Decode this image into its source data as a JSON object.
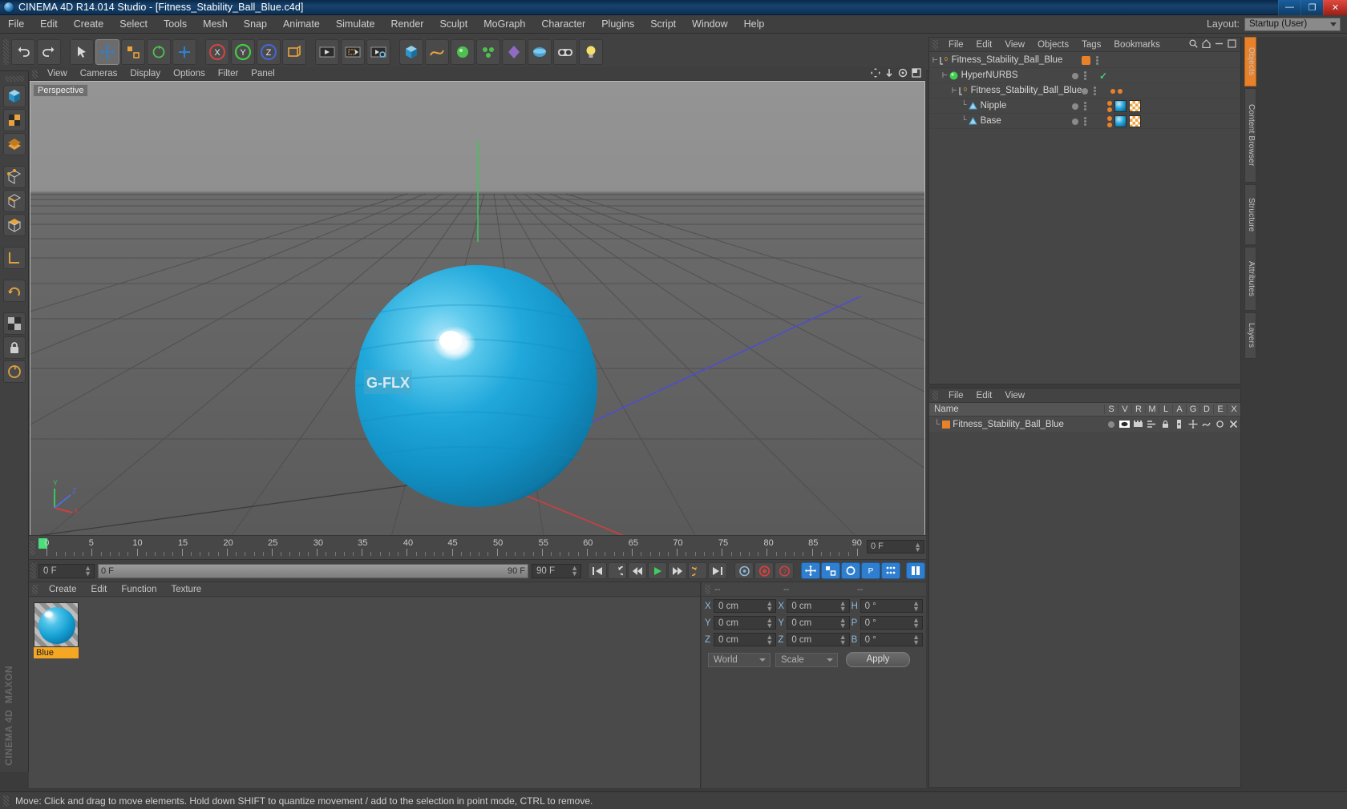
{
  "titlebar": {
    "title": "CINEMA 4D R14.014 Studio - [Fitness_Stability_Ball_Blue.c4d]",
    "app_icon": "c4d-logo-icon",
    "minimize": "—",
    "maximize": "❐",
    "close": "✕"
  },
  "menubar": {
    "items": [
      "File",
      "Edit",
      "Create",
      "Select",
      "Tools",
      "Mesh",
      "Snap",
      "Animate",
      "Simulate",
      "Render",
      "Sculpt",
      "MoGraph",
      "Character",
      "Plugins",
      "Script",
      "Window",
      "Help"
    ],
    "layout_label": "Layout:",
    "layout_value": "Startup (User)"
  },
  "viewport": {
    "menu": [
      "View",
      "Cameras",
      "Display",
      "Options",
      "Filter",
      "Panel"
    ],
    "label": "Perspective",
    "axis_x": "X",
    "axis_y": "Y",
    "axis_z": "Z",
    "logo_text": "G-FLX",
    "ball_color": "#24a8d8"
  },
  "timeline": {
    "ticks": [
      "0",
      "5",
      "10",
      "15",
      "20",
      "25",
      "30",
      "35",
      "40",
      "45",
      "50",
      "55",
      "60",
      "65",
      "70",
      "75",
      "80",
      "85",
      "90"
    ],
    "end_field": "0 F",
    "current_frame": "0 F",
    "range_start": "0 F",
    "range_end": "90 F",
    "max_frame": "90 F"
  },
  "transport": {
    "buttons": [
      {
        "name": "go-to-start-button",
        "glyph": "⏮"
      },
      {
        "name": "play-reverse-button",
        "glyph": "↺"
      },
      {
        "name": "step-back-button",
        "glyph": "◀◀"
      },
      {
        "name": "play-button",
        "glyph": "▶"
      },
      {
        "name": "step-forward-button",
        "glyph": "▶▶"
      },
      {
        "name": "play-forward-loop-button",
        "glyph": "↻"
      },
      {
        "name": "go-to-end-button",
        "glyph": "⏭"
      }
    ],
    "record_buttons": [
      {
        "name": "autokey-button",
        "glyph": "◎"
      },
      {
        "name": "record-button",
        "glyph": "●"
      },
      {
        "name": "keyframe-selection-button",
        "glyph": "?"
      }
    ],
    "param_buttons": [
      {
        "name": "record-position-button",
        "glyph": "✥"
      },
      {
        "name": "record-scale-button",
        "glyph": "❑"
      },
      {
        "name": "record-rotation-button",
        "glyph": "↻"
      },
      {
        "name": "record-param-button",
        "glyph": "P"
      },
      {
        "name": "record-pla-button",
        "glyph": "∷"
      }
    ],
    "timeline_toggle": {
      "name": "timeline-toggle-button",
      "glyph": "‖"
    }
  },
  "material_manager": {
    "menu": [
      "Create",
      "Edit",
      "Function",
      "Texture"
    ],
    "materials": [
      {
        "name": "Blue",
        "color": "#24a8d8",
        "selected": true
      }
    ]
  },
  "coordinates": {
    "header_left": "--",
    "header_mid": "--",
    "header_right": "--",
    "rows": [
      {
        "pos_label": "X",
        "pos_value": "0 cm",
        "size_label": "X",
        "size_value": "0 cm",
        "rot_label": "H",
        "rot_value": "0 °"
      },
      {
        "pos_label": "Y",
        "pos_value": "0 cm",
        "size_label": "Y",
        "size_value": "0 cm",
        "rot_label": "P",
        "rot_value": "0 °"
      },
      {
        "pos_label": "Z",
        "pos_value": "0 cm",
        "size_label": "Z",
        "size_value": "0 cm",
        "rot_label": "B",
        "rot_value": "0 °"
      }
    ],
    "system": "World",
    "mode": "Scale",
    "apply": "Apply"
  },
  "object_manager": {
    "menu": [
      "File",
      "Edit",
      "View",
      "Objects",
      "Tags",
      "Bookmarks"
    ],
    "rows": [
      {
        "indent": 0,
        "icon": "null-object-icon",
        "label": "Fitness_Stability_Ball_Blue",
        "dot": "orange",
        "check": false,
        "tags": []
      },
      {
        "indent": 1,
        "icon": "hypernurbs-icon",
        "label": "HyperNURBS",
        "dot": "grey",
        "check": true,
        "tags": []
      },
      {
        "indent": 2,
        "icon": "null-object-icon",
        "label": "Fitness_Stability_Ball_Blue",
        "dot": "grey",
        "check": false,
        "tags": [
          "small",
          "small"
        ]
      },
      {
        "indent": 3,
        "icon": "polygon-object-icon",
        "label": "Nipple",
        "dot": "grey",
        "check": false,
        "tags": [
          "small",
          "small",
          "material",
          "uv"
        ]
      },
      {
        "indent": 3,
        "icon": "polygon-object-icon",
        "label": "Base",
        "dot": "grey",
        "check": false,
        "tags": [
          "small",
          "small",
          "material",
          "uv"
        ]
      }
    ]
  },
  "attribute_manager": {
    "menu": [
      "File",
      "Edit",
      "View"
    ],
    "columns": [
      "Name",
      "S",
      "V",
      "R",
      "M",
      "L",
      "A",
      "G",
      "D",
      "E",
      "X"
    ],
    "rows": [
      {
        "label": "Fitness_Stability_Ball_Blue",
        "color": "#e8822a"
      }
    ]
  },
  "right_tabs": [
    "Objects",
    "Content Browser",
    "Structure",
    "Attributes",
    "Layers"
  ],
  "statusbar": {
    "text": "Move: Click and drag to move elements. Hold down SHIFT to quantize movement / add to the selection in point mode, CTRL to remove."
  },
  "branding": {
    "maxon": "MAXON",
    "cinema4d": "CINEMA 4D"
  },
  "toolbar": {
    "groups": [
      [
        {
          "name": "undo-button",
          "glyph": "↶"
        },
        {
          "name": "redo-button",
          "glyph": "↷"
        }
      ],
      [
        {
          "name": "live-selection-button",
          "glyph": "➤"
        },
        {
          "name": "move-tool-button",
          "glyph": "✥"
        },
        {
          "name": "scale-tool-button",
          "glyph": "❐"
        },
        {
          "name": "rotate-tool-button",
          "glyph": "↻"
        },
        {
          "name": "transform-tool-button",
          "glyph": "✚"
        }
      ],
      [
        {
          "name": "lock-x-axis-button",
          "glyph": "X"
        },
        {
          "name": "lock-y-axis-button",
          "glyph": "Y"
        },
        {
          "name": "lock-z-axis-button",
          "glyph": "Z"
        },
        {
          "name": "world-coordinates-button",
          "glyph": "◱"
        }
      ],
      [
        {
          "name": "render-view-button",
          "glyph": "▶"
        },
        {
          "name": "render-region-button",
          "glyph": "▣"
        },
        {
          "name": "render-settings-button",
          "glyph": "⚙"
        }
      ],
      [
        {
          "name": "cube-primitive-button",
          "glyph": "■"
        },
        {
          "name": "spline-button",
          "glyph": "∿"
        },
        {
          "name": "nurbs-button",
          "glyph": "●"
        },
        {
          "name": "array-button",
          "glyph": "⁂"
        },
        {
          "name": "deformer-button",
          "glyph": "◆"
        },
        {
          "name": "scene-object-button",
          "glyph": "◔"
        },
        {
          "name": "camera-button",
          "glyph": "◎"
        },
        {
          "name": "light-button",
          "glyph": "○"
        }
      ]
    ]
  },
  "left_toolbar": {
    "buttons": [
      {
        "name": "model-mode-button",
        "glyph": "▢"
      },
      {
        "name": "texture-mode-button",
        "glyph": "▦"
      },
      {
        "name": "polygon-mode-button",
        "glyph": "▤"
      },
      {
        "name": "point-mode-button",
        "glyph": "▣"
      },
      {
        "name": "edge-mode-button",
        "glyph": "▱"
      },
      {
        "name": "polygons-mode-button",
        "glyph": "⬟"
      },
      {
        "name": "axis-mode-button",
        "glyph": "∟"
      },
      {
        "name": "enable-axis-button",
        "glyph": "↺"
      },
      {
        "name": "viewport-solo-button",
        "glyph": "▒"
      },
      {
        "name": "lock-workplane-button",
        "glyph": "⚿"
      },
      {
        "name": "workplane-button",
        "glyph": "⧉"
      }
    ]
  }
}
